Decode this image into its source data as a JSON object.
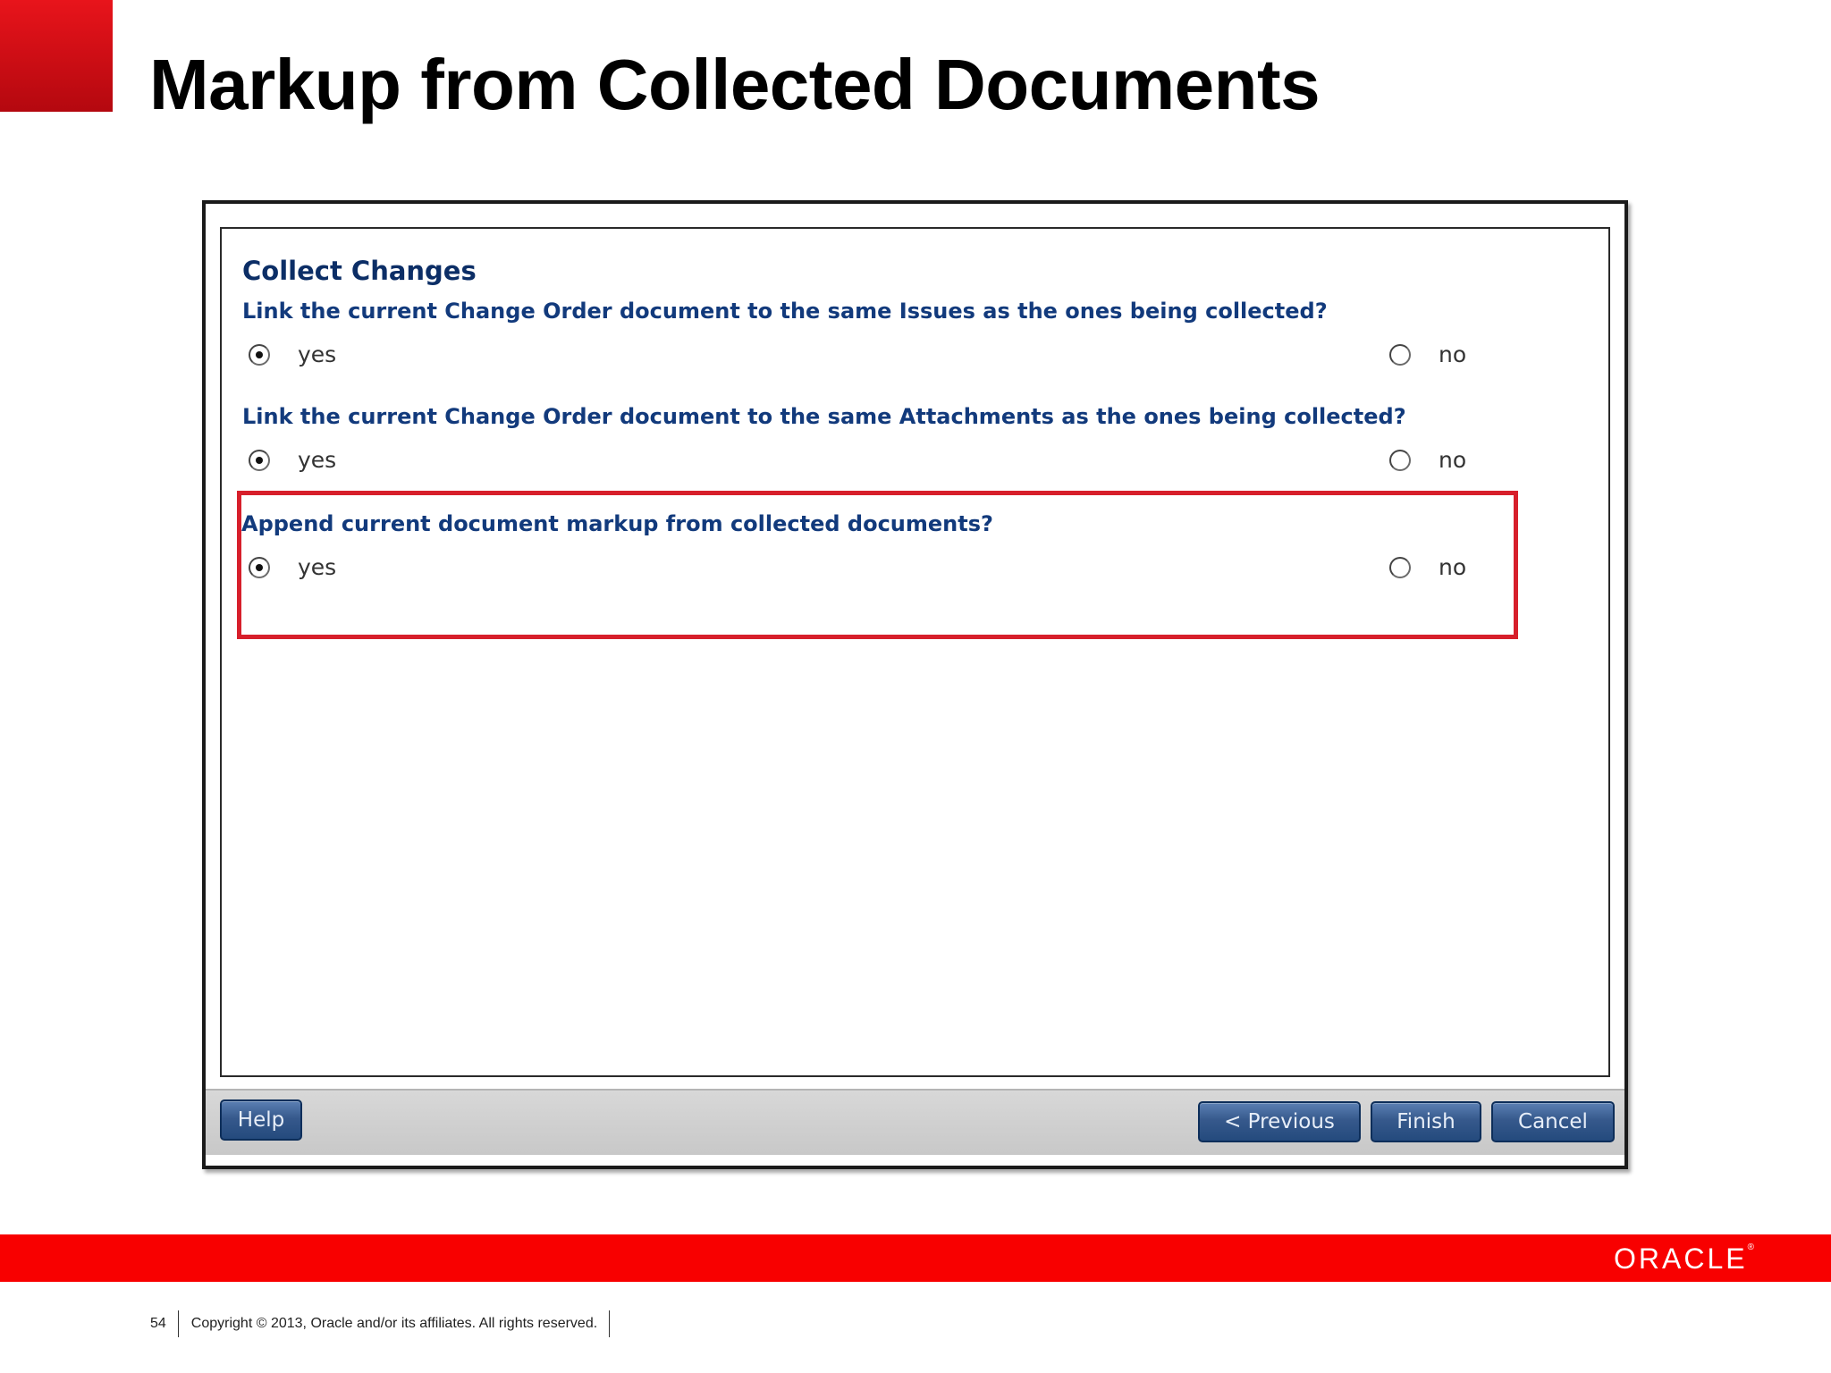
{
  "slide": {
    "title": "Markup from Collected Documents"
  },
  "dialog": {
    "section_title": "Collect Changes",
    "questions": [
      {
        "text": "Link the current Change Order document to the same Issues as the ones being collected?",
        "yes_label": "yes",
        "no_label": "no",
        "selected": "yes"
      },
      {
        "text": "Link the current Change Order document to the same Attachments as the ones being collected?",
        "yes_label": "yes",
        "no_label": "no",
        "selected": "yes"
      },
      {
        "text": "Append current document markup from collected documents?",
        "yes_label": "yes",
        "no_label": "no",
        "selected": "yes"
      }
    ],
    "buttons": {
      "help": "Help",
      "previous": "< Previous",
      "finish": "Finish",
      "cancel": "Cancel"
    },
    "highlight_color": "#d71f2b"
  },
  "footer": {
    "page_number": "54",
    "copyright": "Copyright © 2013, Oracle and/or its affiliates. All rights reserved.",
    "logo_text": "ORACLE",
    "brand_color": "#f80000"
  }
}
